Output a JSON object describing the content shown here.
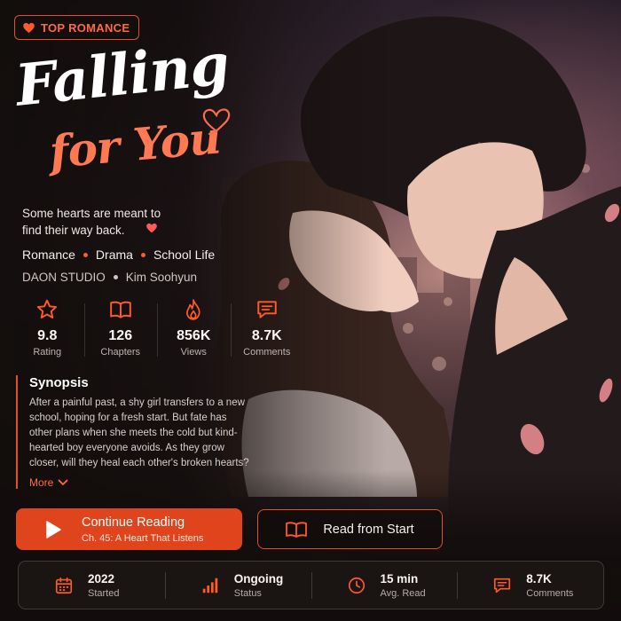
{
  "badge": {
    "label": "TOP ROMANCE",
    "icon": "heart-icon"
  },
  "title": {
    "line1": "Falling",
    "line2": "for You"
  },
  "tagline": "Some hearts are meant to find their way back.",
  "genres": [
    "Romance",
    "Drama",
    "School Life"
  ],
  "credits": {
    "studio": "DAON STUDIO",
    "author": "Kim Soohyun"
  },
  "stats": [
    {
      "icon": "star-icon",
      "value": "9.8",
      "label": "Rating"
    },
    {
      "icon": "book-icon",
      "value": "126",
      "label": "Chapters"
    },
    {
      "icon": "flame-icon",
      "value": "856K",
      "label": "Views"
    },
    {
      "icon": "comment-icon",
      "value": "8.7K",
      "label": "Comments"
    }
  ],
  "synopsis": {
    "heading": "Synopsis",
    "text": "After a painful past, a shy girl transfers to a new school, hoping for a fresh start. But fate has other plans when she meets the cold but kind-hearted boy everyone avoids. As they grow closer, will they heal each other's broken hearts?",
    "more_label": "More"
  },
  "actions": {
    "continue_label": "Continue Reading",
    "continue_chapter": "Ch. 45: A Heart That Listens",
    "start_label": "Read from Start"
  },
  "info": [
    {
      "icon": "calendar-icon",
      "value": "2022",
      "label": "Started"
    },
    {
      "icon": "signal-icon",
      "value": "Ongoing",
      "label": "Status"
    },
    {
      "icon": "clock-icon",
      "value": "15 min",
      "label": "Avg. Read"
    },
    {
      "icon": "comment-icon",
      "value": "8.7K",
      "label": "Comments"
    }
  ],
  "colors": {
    "accent": "#e0441c",
    "accent_text": "#ff6a3a",
    "background": "#16110f"
  }
}
